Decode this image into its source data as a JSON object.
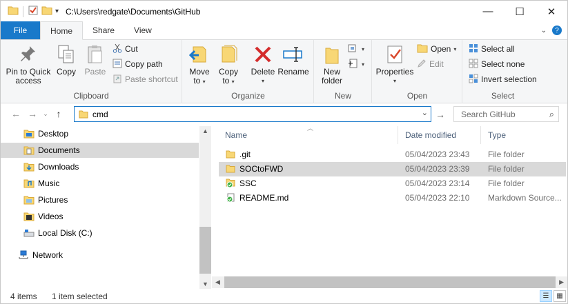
{
  "window": {
    "path": "C:\\Users\\redgate\\Documents\\GitHub",
    "minimize_glyph": "—",
    "maximize_glyph": "☐",
    "close_glyph": "✕"
  },
  "tabs": {
    "file": "File",
    "home": "Home",
    "share": "Share",
    "view": "View"
  },
  "ribbon": {
    "clipboard": {
      "label": "Clipboard",
      "pin_line1": "Pin to Quick",
      "pin_line2": "access",
      "copy": "Copy",
      "paste": "Paste",
      "cut": "Cut",
      "copy_path": "Copy path",
      "paste_shortcut": "Paste shortcut"
    },
    "organize": {
      "label": "Organize",
      "move_to_line1": "Move",
      "move_to_line2": "to",
      "copy_to_line1": "Copy",
      "copy_to_line2": "to",
      "delete": "Delete",
      "rename": "Rename"
    },
    "new": {
      "label": "New",
      "new_folder_line1": "New",
      "new_folder_line2": "folder"
    },
    "open": {
      "label": "Open",
      "properties": "Properties",
      "open": "Open",
      "edit": "Edit"
    },
    "select": {
      "label": "Select",
      "select_all": "Select all",
      "select_none": "Select none",
      "invert_selection": "Invert selection"
    }
  },
  "address": {
    "value": "cmd",
    "search_placeholder": "Search GitHub"
  },
  "nav": {
    "items": [
      {
        "label": "Desktop",
        "icon": "desktop-folder-icon"
      },
      {
        "label": "Documents",
        "icon": "documents-folder-icon"
      },
      {
        "label": "Downloads",
        "icon": "downloads-folder-icon"
      },
      {
        "label": "Music",
        "icon": "music-folder-icon"
      },
      {
        "label": "Pictures",
        "icon": "pictures-folder-icon"
      },
      {
        "label": "Videos",
        "icon": "videos-folder-icon"
      },
      {
        "label": "Local Disk (C:)",
        "icon": "drive-icon"
      },
      {
        "label": "Network",
        "icon": "network-icon"
      }
    ]
  },
  "list": {
    "columns": {
      "name": "Name",
      "date": "Date modified",
      "type": "Type"
    },
    "rows": [
      {
        "name": ".git",
        "date": "05/04/2023 23:43",
        "type": "File folder",
        "icon": "folder-icon"
      },
      {
        "name": "SOCtoFWD",
        "date": "05/04/2023 23:39",
        "type": "File folder",
        "icon": "folder-icon"
      },
      {
        "name": "SSC",
        "date": "05/04/2023 23:14",
        "type": "File folder",
        "icon": "git-synced-folder-icon"
      },
      {
        "name": "README.md",
        "date": "05/04/2023 22:10",
        "type": "Markdown Source...",
        "icon": "git-synced-file-icon"
      }
    ]
  },
  "status": {
    "count": "4 items",
    "selected": "1 item selected"
  },
  "colors": {
    "accent": "#1979ca",
    "selection": "#cce8ff",
    "hover": "#d9d9d9",
    "folder": "#f8d775"
  }
}
